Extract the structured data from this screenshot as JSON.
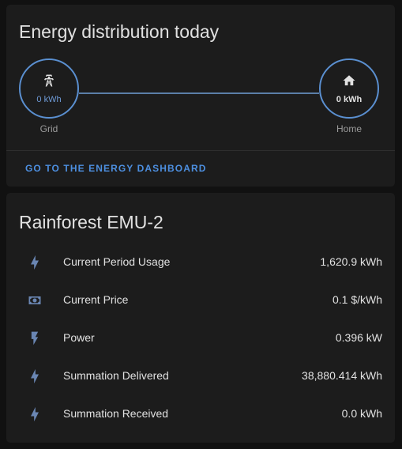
{
  "energy_card": {
    "title": "Energy distribution today",
    "grid": {
      "value": "0 kWh",
      "label": "Grid"
    },
    "home": {
      "value": "0 kWh",
      "label": "Home"
    },
    "action_label": "GO TO THE ENERGY DASHBOARD"
  },
  "device_card": {
    "title": "Rainforest EMU-2",
    "entities": [
      {
        "icon": "lightning-bolt-icon",
        "name": "Current Period Usage",
        "value": "1,620.9 kWh"
      },
      {
        "icon": "cash-icon",
        "name": "Current Price",
        "value": "0.1 $/kWh"
      },
      {
        "icon": "flash-icon",
        "name": "Power",
        "value": "0.396 kW"
      },
      {
        "icon": "lightning-bolt-icon",
        "name": "Summation Delivered",
        "value": "38,880.414 kWh"
      },
      {
        "icon": "lightning-bolt-icon",
        "name": "Summation Received",
        "value": "0.0 kWh"
      }
    ]
  },
  "colors": {
    "background": "#111111",
    "card": "#1c1c1c",
    "accent": "#4d8fe0",
    "grid_ring": "#5a8fd0",
    "icon": "#6a86b3"
  }
}
